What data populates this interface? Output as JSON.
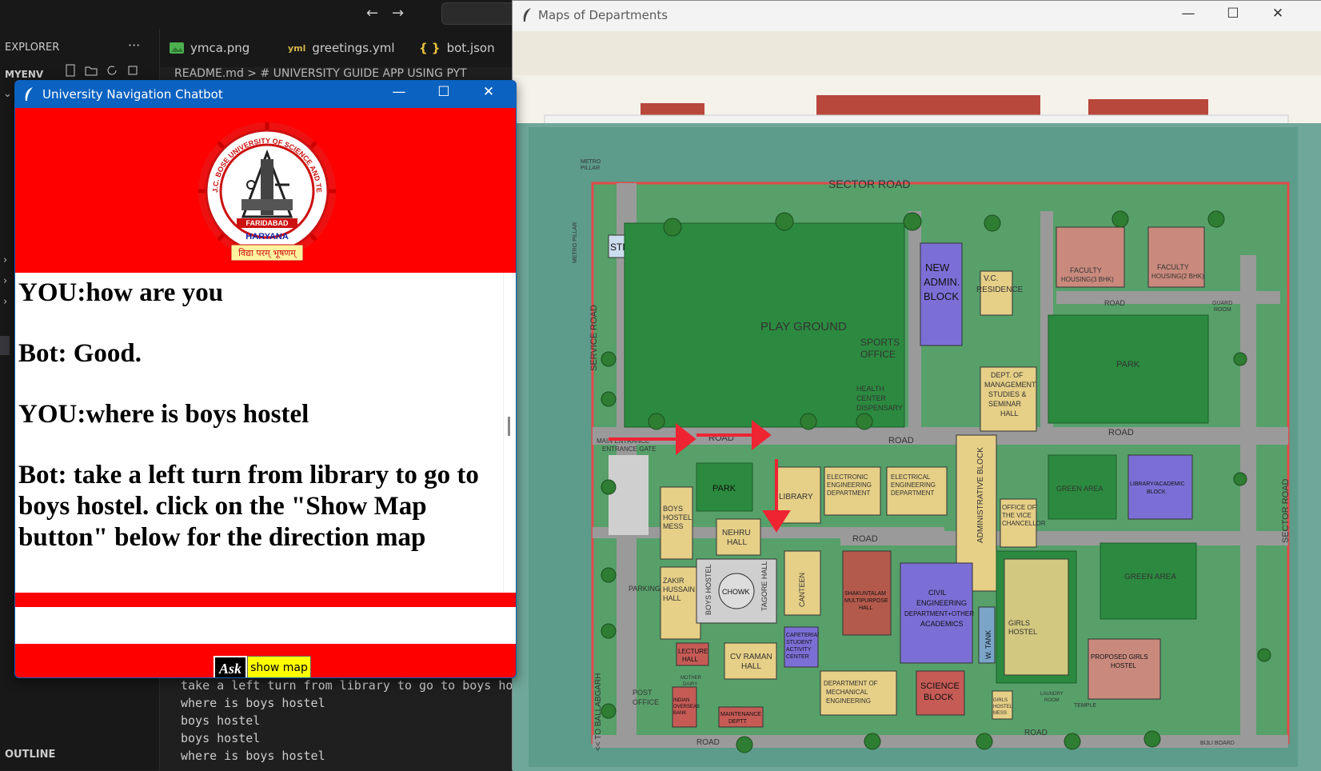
{
  "vscode": {
    "nav_back": "←",
    "nav_forward": "→",
    "explorer_title": "EXPLORER",
    "explorer_more": "···",
    "folder_name": "MYENV",
    "outline_title": "OUTLINE",
    "tabs": [
      {
        "label": "ymca.png",
        "icon": "image-icon"
      },
      {
        "label": "greetings.yml",
        "icon": "yaml-icon"
      },
      {
        "label": "bot.json",
        "icon": "json-icon"
      }
    ],
    "breadcrumb": "README.md > # UNIVERSITY GUIDE APP USING PYT",
    "terminal_lines": [
      "take a left turn from library to go to boys hos",
      "where is boys hostel",
      "boys hostel",
      "boys hostel",
      "where is boys hostel"
    ]
  },
  "chatbot": {
    "window_title": "University Navigation Chatbot",
    "logo": {
      "ring_text": "J.C. BOSE UNIVERSITY OF SCIENCE AND TECHNOLOGY, YMCA",
      "city": "FARIDABAD",
      "state": "HARYANA",
      "motto": "विद्या परम् भूषणम्"
    },
    "messages": [
      "YOU:how are you",
      "Bot: Good.",
      "YOU:where is boys hostel",
      "Bot: take a left turn from library to go to boys hostel. click on the \"Show Map button\" below for the direction map"
    ],
    "input_value": "",
    "ask_label": "Ask",
    "show_map_label": "show map",
    "colors": {
      "background": "#ff0000",
      "titlebar": "#0b62c1",
      "show_map_button": "#ffff00"
    }
  },
  "map_window": {
    "title": "Maps of Departments",
    "labels": {
      "sector_road": "SECTOR ROAD",
      "stp": "STP",
      "new_admin": "NEW ADMIN. BLOCK",
      "vc_residence": "V.C. RESIDENCE",
      "faculty1": "FACULTY HOUSING(3 BHK)",
      "faculty2": "FACULTY HOUSING(2 BHK)",
      "play_ground": "PLAY GROUND",
      "sports_office": "SPORTS OFFICE",
      "health_center": "HEALTH CENTER DISPENSARY",
      "park": "PARK",
      "dept_management": "DEPT. OF MANAGEMENT STUDIES & SEMINAR HALL",
      "road": "ROAD",
      "service_road": "SERVICE ROAD",
      "main_entrance": "MAIN ENTRANCE GATE",
      "library": "LIBRARY",
      "electronic_eng": "ELECTRONIC ENGINEERING DEPARTMENT",
      "electrical_eng": "ELECTRICAL ENGINEERING DEPARTMENT",
      "green_area": "GREEN AREA",
      "library_academic": "LIBRARY/ACADEMIC BLOCK",
      "boys_mess": "BOYS HOSTEL MESS",
      "nehru_hall": "NEHRU HALL",
      "admin_block": "ADMINISTRATIVE BLOCK",
      "vc_office": "OFFICE OF THE VICE CHANCELLOR",
      "zakir_hall": "ZAKIR HUSSAIN HALL",
      "boys_hostel": "BOYS HOSTEL",
      "chowk": "CHOWK",
      "tagore_hall": "TAGORE HALL",
      "canteen": "CANTEEN",
      "shakuntalam": "SHAKUNTALAM MULTIPURPOSE HALL",
      "civil_eng": "CIVIL ENGINEERING DEPARTMENT+OTHER ACADEMICS",
      "w_tank": "W. TANK",
      "girls_hostel": "GIRLS HOSTEL",
      "proposed_girls": "PROPOSED GIRLS HOSTEL",
      "parking": "PARKING",
      "lecture_hall": "LECTURE HALL",
      "cv_raman": "CV RAMAN HALL",
      "cafeteria": "CAFETERIA/ STUDENT ACTIVITY CENTER",
      "dept_mechanical": "DEPARTMENT OF MECHANICAL ENGINEERING",
      "science_block": "SCIENCE BLOCK",
      "post_office": "POST OFFICE",
      "indian_overseas": "INDIAN OVERSEAS BANK",
      "maintenance": "MAINTENANCE DEPTT",
      "girls_mess": "GIRLS HOSTEL MESS",
      "laundry": "LAUNDRY ROOM",
      "temple": "TEMPLE",
      "to_ballabgarh": "<< TO BALLABGARH",
      "metro_pillar": "METRO PILLAR",
      "guard_room": "GUARD ROOM",
      "mother_dairy": "MOTHER DAIRY",
      "sector_road_right": "SECTOR ROAD",
      "bijli_board": "BIJLI BOARD"
    }
  }
}
